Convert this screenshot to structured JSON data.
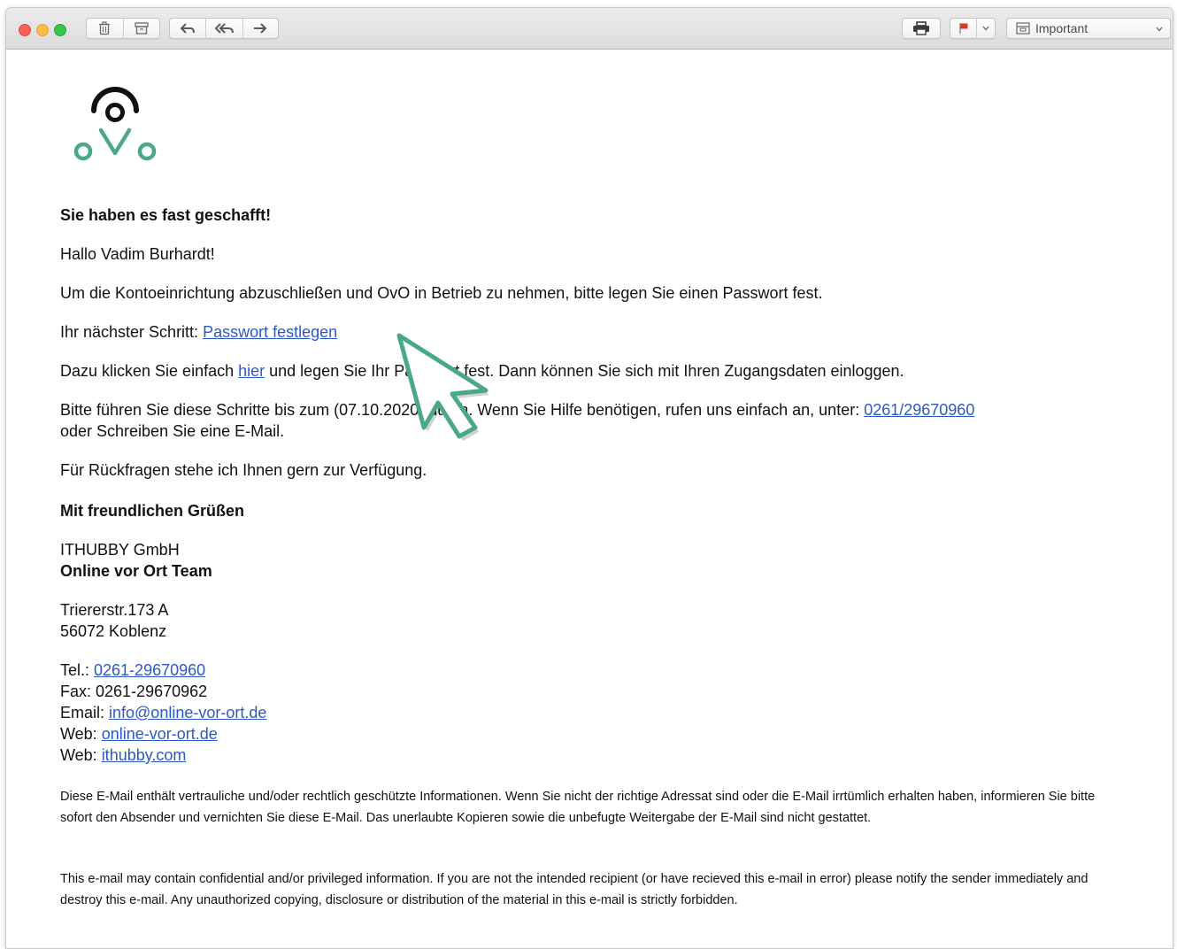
{
  "toolbar": {
    "icons": [
      "trash-icon",
      "archive-icon",
      "reply-icon",
      "reply-all-icon",
      "forward-icon",
      "print-icon",
      "flag-icon",
      "chevron-down-icon",
      "mailbox-icon"
    ],
    "flag_color": "#e0352b",
    "mailbox_label": "Important"
  },
  "email": {
    "heading": "Sie haben es fast geschafft!",
    "greeting": "Hallo Vadim Burhardt!",
    "intro": "Um die Kontoeinrichtung abzuschließen und OvO in Betrieb zu nehmen, bitte legen Sie einen Passwort fest.",
    "next_step_prefix": "Ihr nächster Schritt: ",
    "next_step_link": "Passwort festlegen",
    "click_prefix": "Dazu klicken Sie einfach ",
    "click_link": "hier",
    "click_suffix": " und legen Sie Ihr Passwort fest. Dann können Sie sich mit Ihren Zugangsdaten einloggen.",
    "deadline_text": "Bitte führen Sie diese Schritte bis zum (07.10.2020) durch. Wenn Sie Hilfe benötigen, rufen uns einfach an, unter: ",
    "deadline_phone_link": "0261/29670960",
    "deadline_suffix": "oder Schreiben Sie eine E-Mail.",
    "questions": "Für Rückfragen stehe ich Ihnen gern zur Verfügung.",
    "closing": "Mit freundlichen Grüßen",
    "company": "ITHUBBY GmbH",
    "team": "Online vor Ort Team",
    "street": "Triererstr.173 A",
    "city": "56072 Koblenz",
    "tel_label": "Tel.: ",
    "tel_value": "0261-29670960",
    "fax_label": "Fax: ",
    "fax_value": "0261-29670962",
    "email_label": "Email: ",
    "email_value": "info@online-vor-ort.de",
    "web1_label": "Web: ",
    "web1_value": "online-vor-ort.de",
    "web2_label": "Web: ",
    "web2_value": "ithubby.com",
    "disclaimer_de": "Diese E-Mail enthält vertrauliche und/oder rechtlich geschützte Informationen. Wenn Sie nicht der richtige Adressat sind oder die E-Mail irrtümlich erhalten haben, informieren Sie bitte sofort den Absender und vernichten Sie diese E-Mail. Das unerlaubte Kopieren sowie die unbefugte Weitergabe der E-Mail sind nicht gestattet.",
    "disclaimer_en": "This e-mail may contain confidential and/or privileged information. If you are not the intended recipient (or have recieved this e-mail in error) please notify the sender immediately and destroy this e-mail. Any unauthorized copying, disclosure or distribution of the material in this e-mail is strictly forbidden."
  },
  "colors": {
    "logo_green": "#4aa88a",
    "link": "#2a59c7",
    "cursor_green": "#4aa88a"
  }
}
